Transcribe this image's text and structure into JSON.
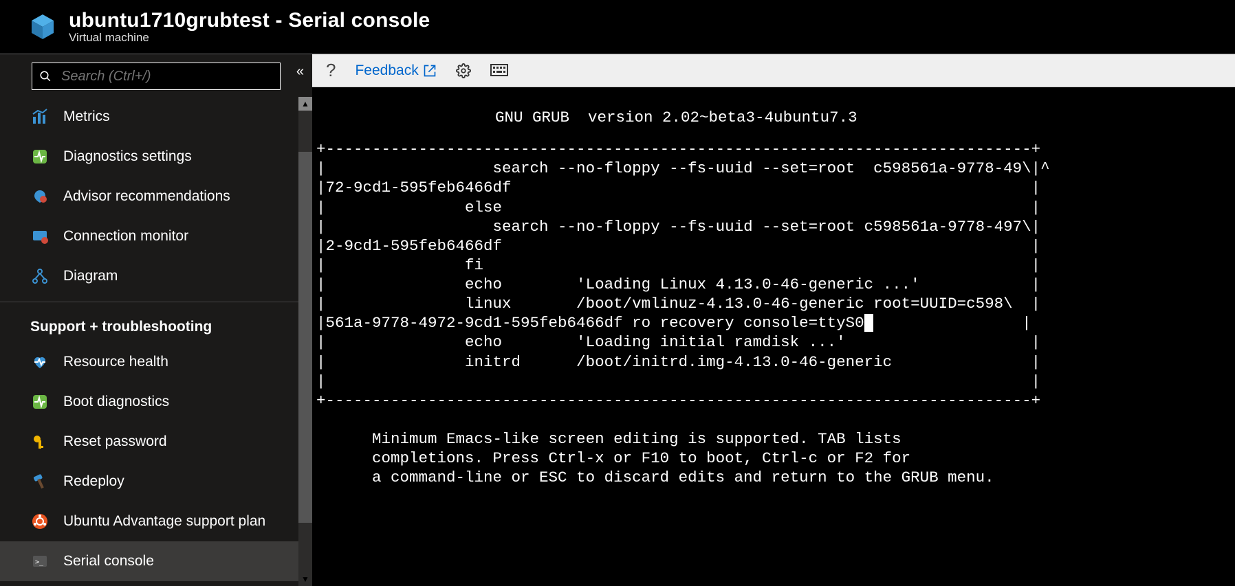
{
  "header": {
    "title": "ubuntu1710grubtest - Serial console",
    "subtitle": "Virtual machine"
  },
  "search": {
    "placeholder": "Search (Ctrl+/)"
  },
  "sidebar": {
    "items": [
      {
        "id": "metrics",
        "label": "Metrics"
      },
      {
        "id": "diagnostics-settings",
        "label": "Diagnostics settings"
      },
      {
        "id": "advisor-recommendations",
        "label": "Advisor recommendations"
      },
      {
        "id": "connection-monitor",
        "label": "Connection monitor"
      },
      {
        "id": "diagram",
        "label": "Diagram"
      }
    ],
    "section_label": "Support + troubleshooting",
    "support_items": [
      {
        "id": "resource-health",
        "label": "Resource health"
      },
      {
        "id": "boot-diagnostics",
        "label": "Boot diagnostics"
      },
      {
        "id": "reset-password",
        "label": "Reset password"
      },
      {
        "id": "redeploy",
        "label": "Redeploy"
      },
      {
        "id": "ubuntu-advantage",
        "label": "Ubuntu Advantage support plan"
      },
      {
        "id": "serial-console",
        "label": "Serial console"
      }
    ]
  },
  "toolbar": {
    "help": "?",
    "feedback": "Feedback"
  },
  "terminal": {
    "title": "GNU GRUB  version 2.02~beta3-4ubuntu7.3",
    "top_border": "+----------------------------------------------------------------------------+",
    "l1": "|                  search --no-floppy --fs-uuid --set=root  c598561a-9778-49\\|^",
    "l2": "|72-9cd1-595feb6466df                                                        |",
    "l3": "|               else                                                         |",
    "l4": "|                  search --no-floppy --fs-uuid --set=root c598561a-9778-497\\|",
    "l5": "|2-9cd1-595feb6466df                                                         |",
    "l6": "|               fi                                                           |",
    "l7": "|               echo        'Loading Linux 4.13.0-46-generic ...'            |",
    "l8": "|               linux       /boot/vmlinuz-4.13.0-46-generic root=UUID=c598\\  |",
    "l9a": "|561a-9778-4972-9cd1-595feb6466df ro recovery console=ttyS0",
    "l9b": "                |",
    "l10": "|               echo        'Loading initial ramdisk ...'                    |",
    "l11": "|               initrd      /boot/initrd.img-4.13.0-46-generic               |",
    "l12": "|                                                                            |",
    "bot_border": "+----------------------------------------------------------------------------+",
    "hint1": "      Minimum Emacs-like screen editing is supported. TAB lists",
    "hint2": "      completions. Press Ctrl-x or F10 to boot, Ctrl-c or F2 for",
    "hint3": "      a command-line or ESC to discard edits and return to the GRUB menu."
  }
}
